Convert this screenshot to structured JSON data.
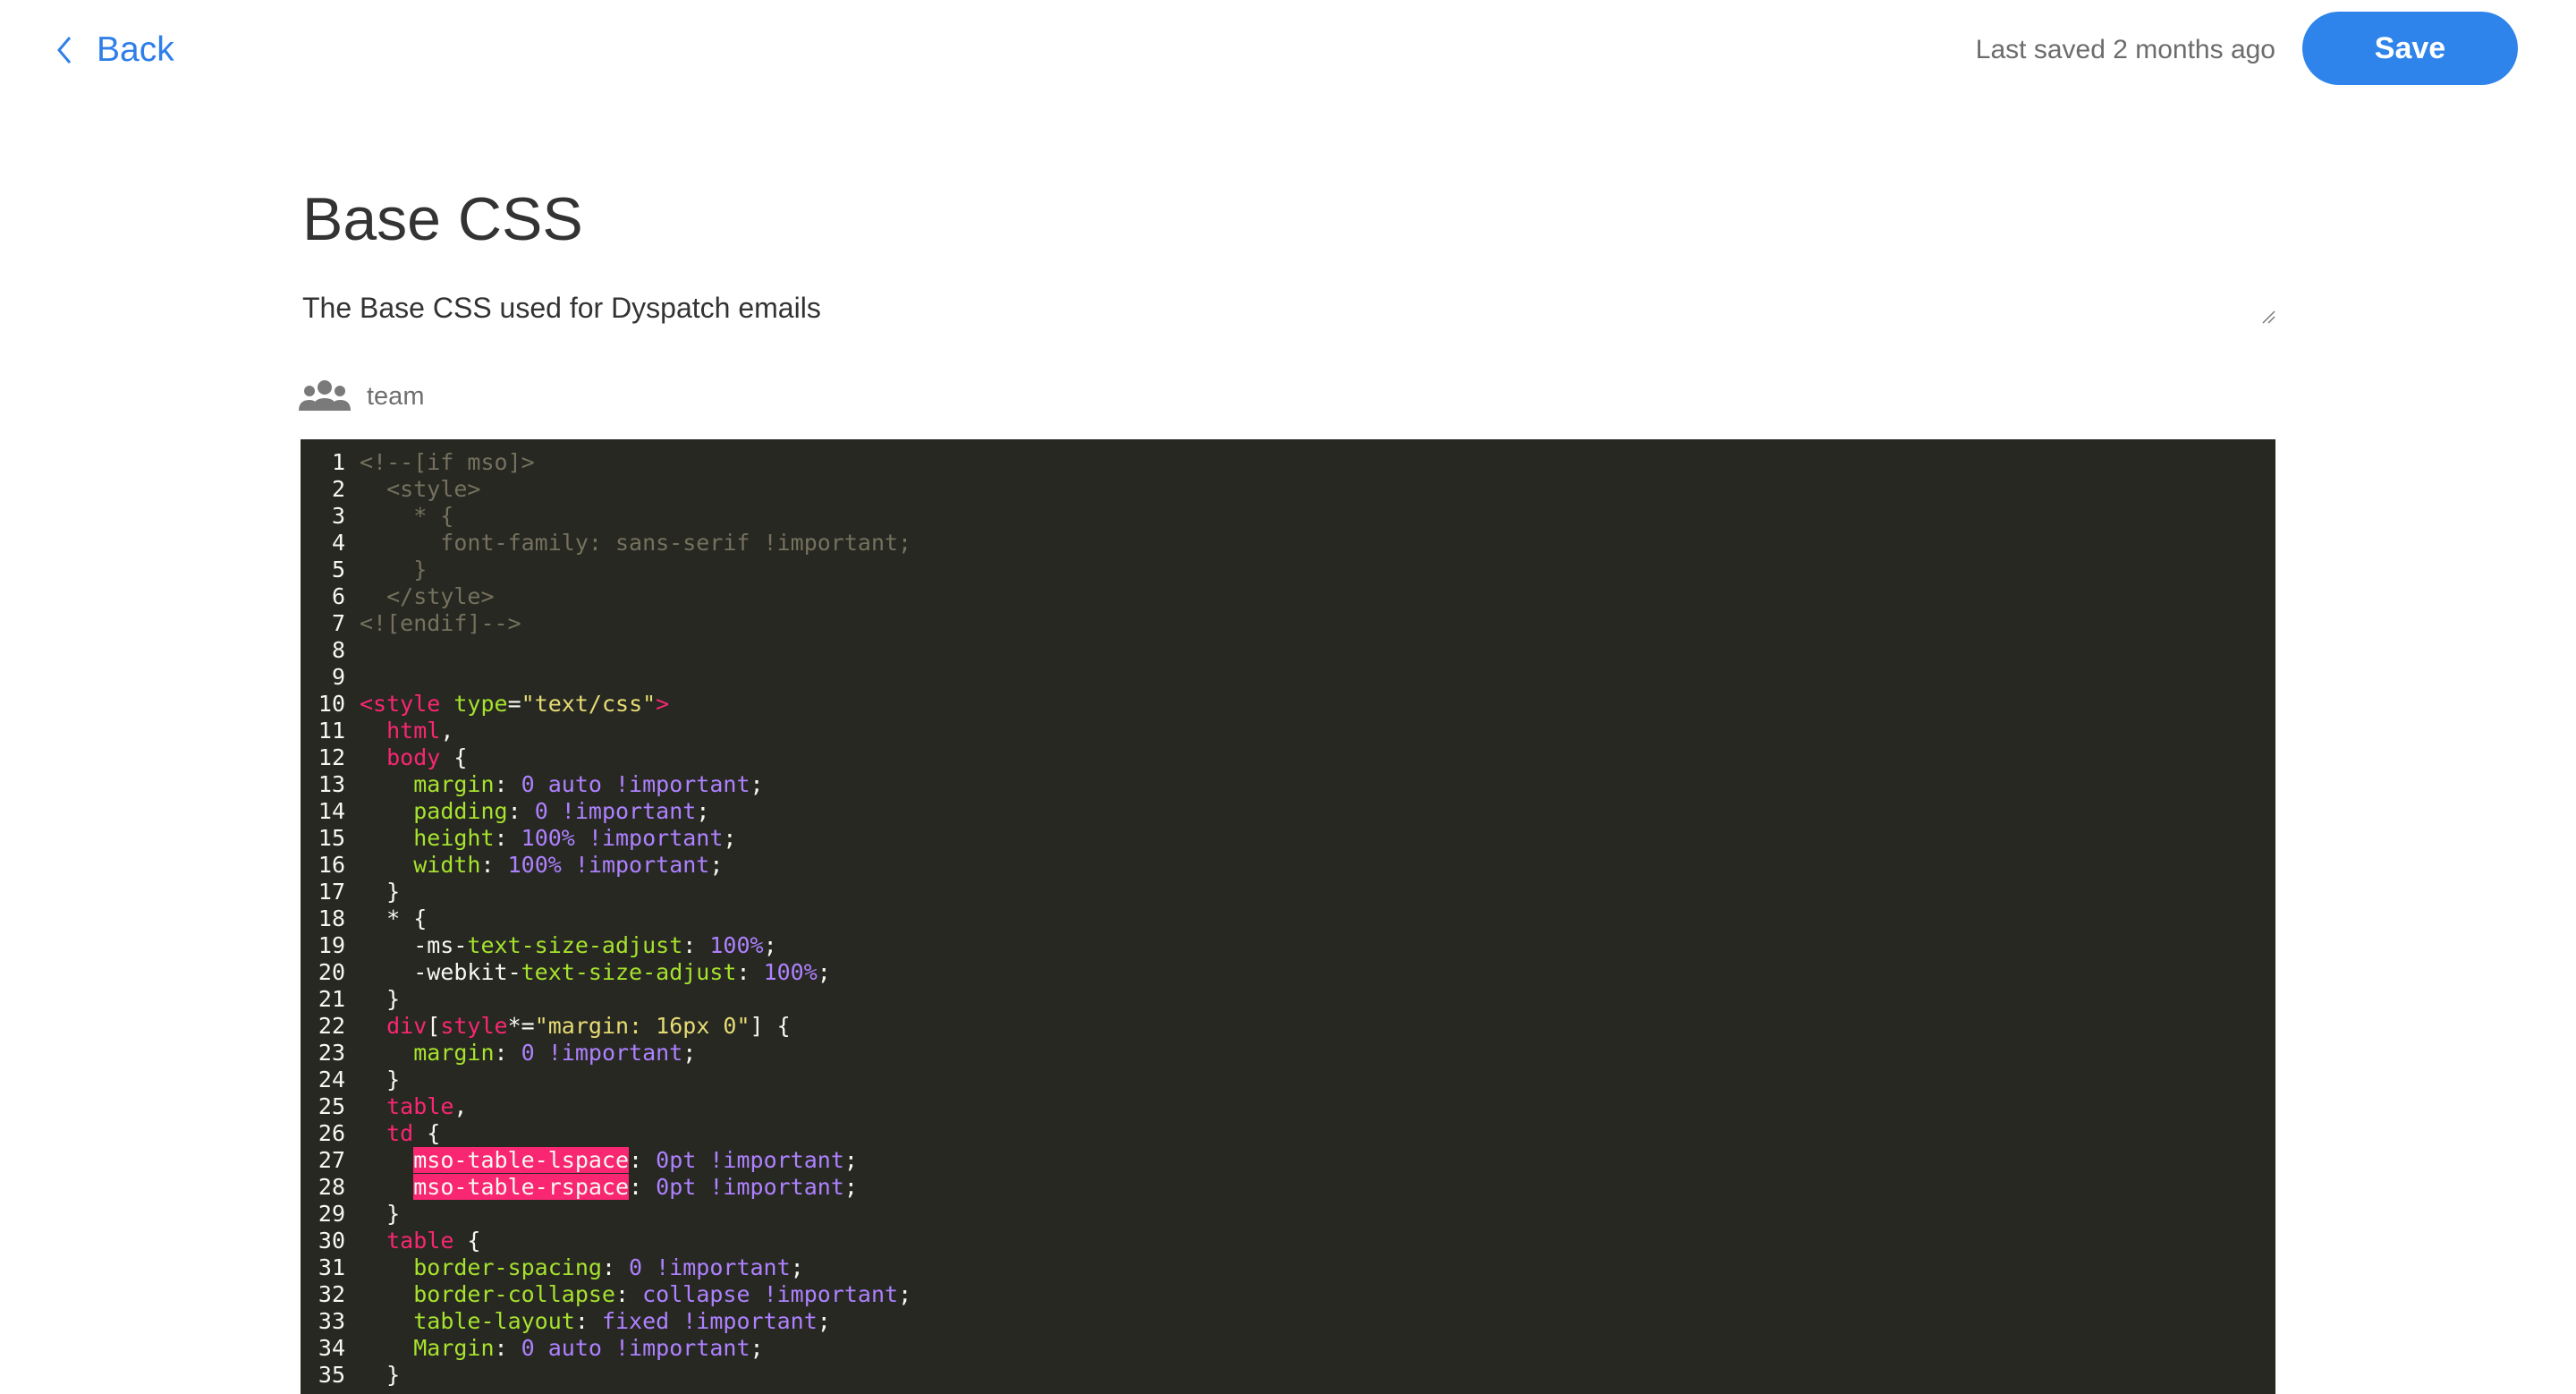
{
  "header": {
    "back_label": "Back",
    "last_saved": "Last saved 2 months ago",
    "save_label": "Save"
  },
  "document": {
    "title": "Base CSS",
    "description": "The Base CSS used for Dyspatch emails",
    "scope_label": "team"
  },
  "editor": {
    "lines": [
      {
        "n": "1",
        "tokens": [
          [
            "c",
            "<!--[if mso]>"
          ]
        ]
      },
      {
        "n": "2",
        "tokens": [
          [
            "c",
            "  <style>"
          ]
        ]
      },
      {
        "n": "3",
        "tokens": [
          [
            "c",
            "    * {"
          ]
        ]
      },
      {
        "n": "4",
        "tokens": [
          [
            "c",
            "      font-family: sans-serif !important;"
          ]
        ]
      },
      {
        "n": "5",
        "tokens": [
          [
            "c",
            "    }"
          ]
        ]
      },
      {
        "n": "6",
        "tokens": [
          [
            "c",
            "  </style>"
          ]
        ]
      },
      {
        "n": "7",
        "tokens": [
          [
            "c",
            "<![endif]-->"
          ]
        ]
      },
      {
        "n": "8",
        "tokens": []
      },
      {
        "n": "9",
        "tokens": []
      },
      {
        "n": "10",
        "tokens": [
          [
            "tg",
            "<style"
          ],
          [
            "pl",
            " "
          ],
          [
            "at",
            "type"
          ],
          [
            "pl",
            "="
          ],
          [
            "st",
            "\"text/css\""
          ],
          [
            "tg",
            ">"
          ]
        ]
      },
      {
        "n": "11",
        "tokens": [
          [
            "pl",
            "  "
          ],
          [
            "tg",
            "html"
          ],
          [
            "pl",
            ","
          ]
        ]
      },
      {
        "n": "12",
        "tokens": [
          [
            "pl",
            "  "
          ],
          [
            "tg",
            "body"
          ],
          [
            "pl",
            " {"
          ]
        ]
      },
      {
        "n": "13",
        "tokens": [
          [
            "pl",
            "    "
          ],
          [
            "pr",
            "margin"
          ],
          [
            "pl",
            ": "
          ],
          [
            "nm",
            "0 auto !important"
          ],
          [
            "pl",
            ";"
          ]
        ]
      },
      {
        "n": "14",
        "tokens": [
          [
            "pl",
            "    "
          ],
          [
            "pr",
            "padding"
          ],
          [
            "pl",
            ": "
          ],
          [
            "nm",
            "0 !important"
          ],
          [
            "pl",
            ";"
          ]
        ]
      },
      {
        "n": "15",
        "tokens": [
          [
            "pl",
            "    "
          ],
          [
            "pr",
            "height"
          ],
          [
            "pl",
            ": "
          ],
          [
            "nm",
            "100% !important"
          ],
          [
            "pl",
            ";"
          ]
        ]
      },
      {
        "n": "16",
        "tokens": [
          [
            "pl",
            "    "
          ],
          [
            "pr",
            "width"
          ],
          [
            "pl",
            ": "
          ],
          [
            "nm",
            "100% !important"
          ],
          [
            "pl",
            ";"
          ]
        ]
      },
      {
        "n": "17",
        "tokens": [
          [
            "pl",
            "  }"
          ]
        ]
      },
      {
        "n": "18",
        "tokens": [
          [
            "pl",
            "  * {"
          ]
        ]
      },
      {
        "n": "19",
        "tokens": [
          [
            "pl",
            "    -ms-"
          ],
          [
            "pr",
            "text-size-adjust"
          ],
          [
            "pl",
            ": "
          ],
          [
            "nm",
            "100%"
          ],
          [
            "pl",
            ";"
          ]
        ]
      },
      {
        "n": "20",
        "tokens": [
          [
            "pl",
            "    -webkit-"
          ],
          [
            "pr",
            "text-size-adjust"
          ],
          [
            "pl",
            ": "
          ],
          [
            "nm",
            "100%"
          ],
          [
            "pl",
            ";"
          ]
        ]
      },
      {
        "n": "21",
        "tokens": [
          [
            "pl",
            "  }"
          ]
        ]
      },
      {
        "n": "22",
        "tokens": [
          [
            "pl",
            "  "
          ],
          [
            "tg",
            "div"
          ],
          [
            "pl",
            "["
          ],
          [
            "tg",
            "style"
          ],
          [
            "pl",
            "*="
          ],
          [
            "st",
            "\"margin: 16px 0\""
          ],
          [
            "pl",
            "] {"
          ]
        ]
      },
      {
        "n": "23",
        "tokens": [
          [
            "pl",
            "    "
          ],
          [
            "pr",
            "margin"
          ],
          [
            "pl",
            ": "
          ],
          [
            "nm",
            "0 !important"
          ],
          [
            "pl",
            ";"
          ]
        ]
      },
      {
        "n": "24",
        "tokens": [
          [
            "pl",
            "  }"
          ]
        ]
      },
      {
        "n": "25",
        "tokens": [
          [
            "pl",
            "  "
          ],
          [
            "tg",
            "table"
          ],
          [
            "pl",
            ","
          ]
        ]
      },
      {
        "n": "26",
        "tokens": [
          [
            "pl",
            "  "
          ],
          [
            "tg",
            "td"
          ],
          [
            "pl",
            " {"
          ]
        ]
      },
      {
        "n": "27",
        "tokens": [
          [
            "pl",
            "    "
          ],
          [
            "hl",
            "mso-table-lspace"
          ],
          [
            "pl",
            ": "
          ],
          [
            "nm",
            "0pt !important"
          ],
          [
            "pl",
            ";"
          ]
        ]
      },
      {
        "n": "28",
        "tokens": [
          [
            "pl",
            "    "
          ],
          [
            "hl",
            "mso-table-rspace"
          ],
          [
            "pl",
            ": "
          ],
          [
            "nm",
            "0pt !important"
          ],
          [
            "pl",
            ";"
          ]
        ]
      },
      {
        "n": "29",
        "tokens": [
          [
            "pl",
            "  }"
          ]
        ]
      },
      {
        "n": "30",
        "tokens": [
          [
            "pl",
            "  "
          ],
          [
            "tg",
            "table"
          ],
          [
            "pl",
            " {"
          ]
        ]
      },
      {
        "n": "31",
        "tokens": [
          [
            "pl",
            "    "
          ],
          [
            "pr",
            "border-spacing"
          ],
          [
            "pl",
            ": "
          ],
          [
            "nm",
            "0 !important"
          ],
          [
            "pl",
            ";"
          ]
        ]
      },
      {
        "n": "32",
        "tokens": [
          [
            "pl",
            "    "
          ],
          [
            "pr",
            "border-collapse"
          ],
          [
            "pl",
            ": "
          ],
          [
            "nm",
            "collapse !important"
          ],
          [
            "pl",
            ";"
          ]
        ]
      },
      {
        "n": "33",
        "tokens": [
          [
            "pl",
            "    "
          ],
          [
            "pr",
            "table-layout"
          ],
          [
            "pl",
            ": "
          ],
          [
            "nm",
            "fixed !important"
          ],
          [
            "pl",
            ";"
          ]
        ]
      },
      {
        "n": "34",
        "tokens": [
          [
            "pl",
            "    "
          ],
          [
            "pr",
            "Margin"
          ],
          [
            "pl",
            ": "
          ],
          [
            "nm",
            "0 auto !important"
          ],
          [
            "pl",
            ";"
          ]
        ]
      },
      {
        "n": "35",
        "tokens": [
          [
            "pl",
            "  }"
          ]
        ]
      }
    ]
  }
}
